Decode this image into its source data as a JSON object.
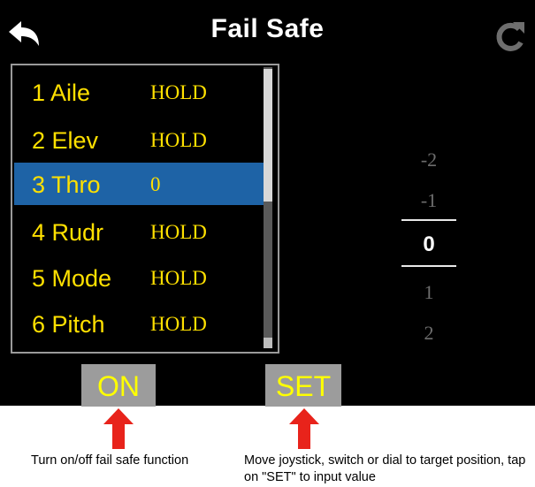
{
  "header": {
    "title": "Fail Safe"
  },
  "channels": [
    {
      "label": "1 Aile",
      "value": "HOLD",
      "selected": false
    },
    {
      "label": "2 Elev",
      "value": "HOLD",
      "selected": false
    },
    {
      "label": "3 Thro",
      "value": "0",
      "selected": true
    },
    {
      "label": "4 Rudr",
      "value": "HOLD",
      "selected": false
    },
    {
      "label": "5 Mode",
      "value": "HOLD",
      "selected": false
    },
    {
      "label": "6 Pitch",
      "value": "HOLD",
      "selected": false
    }
  ],
  "dial": {
    "above": [
      "-2",
      "-1"
    ],
    "current": "0",
    "below": [
      "1",
      "2"
    ]
  },
  "buttons": {
    "on_label": "ON",
    "set_label": "SET"
  },
  "captions": {
    "on": "Turn on/off fail safe function",
    "set": "Move joystick, switch or dial to target position, tap on \"SET\" to input value"
  },
  "colors": {
    "screen_bg": "#000000",
    "text_yellow": "#ffe000",
    "selected_row": "#1e63a6",
    "button_gray": "#9c9c9c",
    "arrow_red": "#e8231b"
  },
  "icons": {
    "back": "back-arrow-icon",
    "refresh": "refresh-icon",
    "arrow": "up-arrow-icon"
  }
}
